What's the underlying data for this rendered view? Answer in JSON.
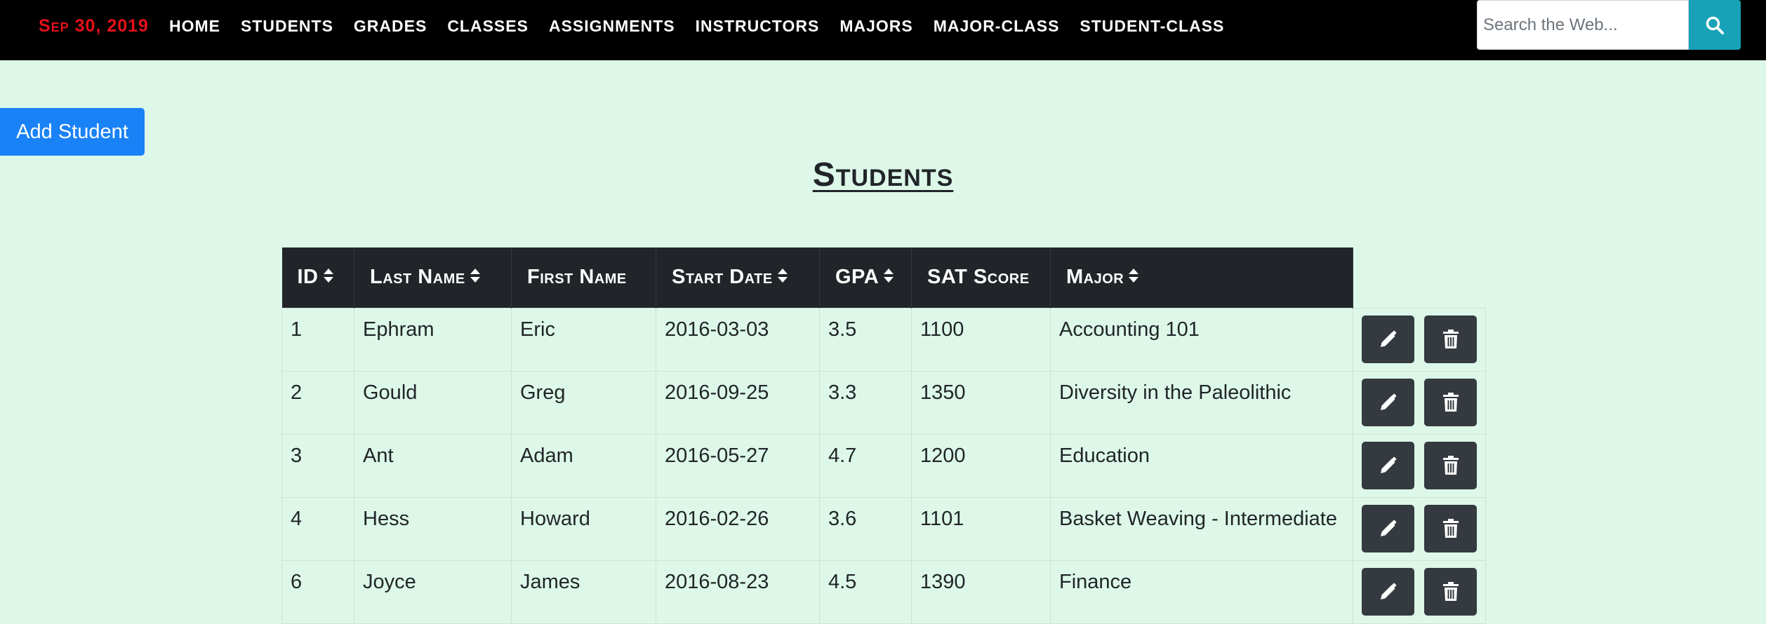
{
  "navbar": {
    "brand": "Sep 30, 2019",
    "links": [
      "HOME",
      "STUDENTS",
      "GRADES",
      "CLASSES",
      "ASSIGNMENTS",
      "INSTRUCTORS",
      "MAJORS",
      "MAJOR-CLASS",
      "STUDENT-CLASS"
    ],
    "search_placeholder": "Search the Web...",
    "search_icon": "search-icon"
  },
  "add_button_label": "Add Student",
  "page_title": "Students",
  "table": {
    "columns": [
      {
        "label": "ID",
        "sortable": true
      },
      {
        "label": "Last Name",
        "sortable": true
      },
      {
        "label": "First Name",
        "sortable": false
      },
      {
        "label": "Start Date",
        "sortable": true
      },
      {
        "label": "GPA",
        "sortable": true
      },
      {
        "label": "SAT Score",
        "sortable": false
      },
      {
        "label": "Major",
        "sortable": true
      }
    ],
    "rows": [
      [
        "1",
        "Ephram",
        "Eric",
        "2016-03-03",
        "3.5",
        "1100",
        "Accounting 101"
      ],
      [
        "2",
        "Gould",
        "Greg",
        "2016-09-25",
        "3.3",
        "1350",
        "Diversity in the Paleolithic"
      ],
      [
        "3",
        "Ant",
        "Adam",
        "2016-05-27",
        "4.7",
        "1200",
        "Education"
      ],
      [
        "4",
        "Hess",
        "Howard",
        "2016-02-26",
        "3.6",
        "1101",
        "Basket Weaving - Intermediate"
      ],
      [
        "6",
        "Joyce",
        "James",
        "2016-08-23",
        "4.5",
        "1390",
        "Finance"
      ]
    ],
    "row_actions": [
      "pencil-icon",
      "trash-icon"
    ]
  },
  "colors": {
    "background": "#ddf8e9",
    "navbar": "#000000",
    "brand": "#e8101c",
    "add_button": "#1a82f7",
    "search_button": "#17a2b8",
    "table_header": "#212529",
    "action_button": "#343a40"
  }
}
